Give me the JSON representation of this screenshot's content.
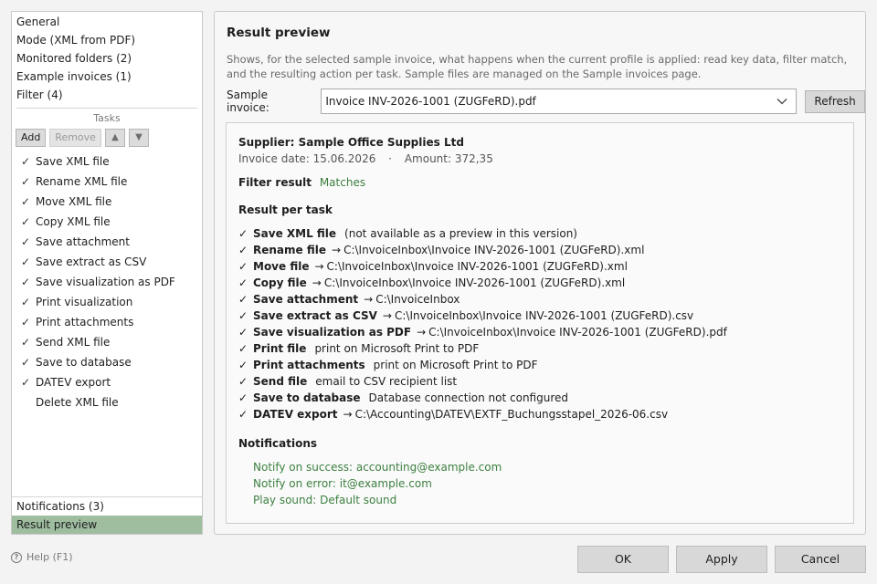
{
  "sidebar": {
    "nav_top": [
      "General",
      "Mode (XML from PDF)",
      "Monitored folders (2)",
      "Example invoices (1)",
      "Filter (4)"
    ],
    "tasks_header": "Tasks",
    "toolbar": {
      "add": "Add",
      "remove": "Remove"
    },
    "tasks": [
      {
        "checked": "✓",
        "label": "Save XML file"
      },
      {
        "checked": "✓",
        "label": "Rename XML file"
      },
      {
        "checked": "✓",
        "label": "Move XML file"
      },
      {
        "checked": "✓",
        "label": "Copy XML file"
      },
      {
        "checked": "✓",
        "label": "Save attachment"
      },
      {
        "checked": "✓",
        "label": "Save extract as CSV"
      },
      {
        "checked": "✓",
        "label": "Save visualization as PDF"
      },
      {
        "checked": "✓",
        "label": "Print visualization"
      },
      {
        "checked": "✓",
        "label": "Print attachments"
      },
      {
        "checked": "✓",
        "label": "Send XML file"
      },
      {
        "checked": "✓",
        "label": "Save to database"
      },
      {
        "checked": "✓",
        "label": "DATEV export"
      },
      {
        "checked": "",
        "label": "Delete XML file"
      }
    ],
    "nav_bottom": [
      "Notifications (3)",
      "Result preview"
    ],
    "selected": "Result preview"
  },
  "help": "Help (F1)",
  "main": {
    "title": "Result preview",
    "description": "Shows, for the selected sample invoice, what happens when the current profile is applied: read key data, filter match, and the resulting action per task. Sample files are managed on the Sample invoices page.",
    "sample_label": "Sample invoice:",
    "sample_value": "Invoice INV-2026-1001 (ZUGFeRD).pdf",
    "refresh": "Refresh",
    "result": {
      "supplier": "Supplier: Sample Office Supplies Ltd",
      "invoice_date": "Invoice date: 15.06.2026",
      "separator": "·",
      "amount": "Amount: 372,35",
      "filter_label": "Filter result",
      "filter_value": "Matches",
      "per_task_heading": "Result per task",
      "tasks": [
        {
          "name": "Save XML file",
          "arrow": "",
          "detail": "(not available as a preview in this version)"
        },
        {
          "name": "Rename file",
          "arrow": "→",
          "detail": "C:\\InvoiceInbox\\Invoice INV-2026-1001 (ZUGFeRD).xml"
        },
        {
          "name": "Move file",
          "arrow": "→",
          "detail": "C:\\InvoiceInbox\\Invoice INV-2026-1001 (ZUGFeRD).xml"
        },
        {
          "name": "Copy file",
          "arrow": "→",
          "detail": "C:\\InvoiceInbox\\Invoice INV-2026-1001 (ZUGFeRD).xml"
        },
        {
          "name": "Save attachment",
          "arrow": "→",
          "detail": "C:\\InvoiceInbox"
        },
        {
          "name": "Save extract as CSV",
          "arrow": "→",
          "detail": "C:\\InvoiceInbox\\Invoice INV-2026-1001 (ZUGFeRD).csv"
        },
        {
          "name": "Save visualization as PDF",
          "arrow": "→",
          "detail": "C:\\InvoiceInbox\\Invoice INV-2026-1001 (ZUGFeRD).pdf"
        },
        {
          "name": "Print file",
          "arrow": "",
          "detail": "print on Microsoft Print to PDF"
        },
        {
          "name": "Print attachments",
          "arrow": "",
          "detail": "print on Microsoft Print to PDF"
        },
        {
          "name": "Send file",
          "arrow": "",
          "detail": "email to CSV recipient list"
        },
        {
          "name": "Save to database",
          "arrow": "",
          "detail": "Database connection not configured"
        },
        {
          "name": "DATEV export",
          "arrow": "→",
          "detail": "C:\\Accounting\\DATEV\\EXTF_Buchungsstapel_2026-06.csv"
        }
      ],
      "check": "✓",
      "notifications_heading": "Notifications",
      "notifications": [
        "Notify on success: accounting@example.com",
        "Notify on error: it@example.com",
        "Play sound: Default sound"
      ]
    }
  },
  "buttons": {
    "ok": "OK",
    "apply": "Apply",
    "cancel": "Cancel"
  },
  "colors": {
    "selected_bg": "#9fbea0",
    "success_green": "#3d8040"
  }
}
